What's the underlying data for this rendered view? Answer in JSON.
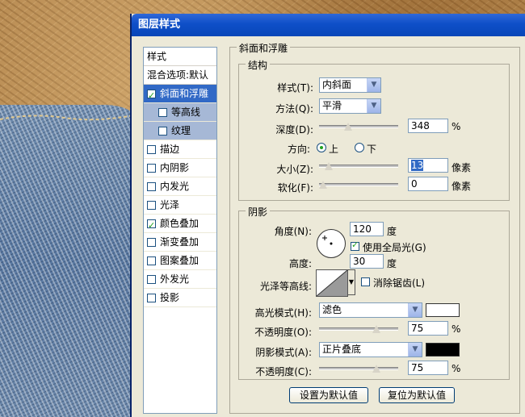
{
  "window": {
    "title": "图层样式"
  },
  "styles": {
    "header": "样式",
    "blend_default": "混合选项:默认",
    "items": [
      {
        "label": "斜面和浮雕",
        "checked": true,
        "selected": true,
        "sub": false
      },
      {
        "label": "等高线",
        "checked": false,
        "selected": false,
        "sub": true
      },
      {
        "label": "纹理",
        "checked": false,
        "selected": false,
        "sub": true
      },
      {
        "label": "描边",
        "checked": false,
        "selected": false,
        "sub": false
      },
      {
        "label": "内阴影",
        "checked": false,
        "selected": false,
        "sub": false
      },
      {
        "label": "内发光",
        "checked": false,
        "selected": false,
        "sub": false
      },
      {
        "label": "光泽",
        "checked": false,
        "selected": false,
        "sub": false
      },
      {
        "label": "颜色叠加",
        "checked": true,
        "selected": false,
        "sub": false
      },
      {
        "label": "渐变叠加",
        "checked": false,
        "selected": false,
        "sub": false
      },
      {
        "label": "图案叠加",
        "checked": false,
        "selected": false,
        "sub": false
      },
      {
        "label": "外发光",
        "checked": false,
        "selected": false,
        "sub": false
      },
      {
        "label": "投影",
        "checked": false,
        "selected": false,
        "sub": false
      }
    ]
  },
  "bevel": {
    "group_title": "斜面和浮雕",
    "structure_title": "结构",
    "style_label": "样式(T):",
    "style_value": "内斜面",
    "technique_label": "方法(Q):",
    "technique_value": "平滑",
    "depth_label": "深度(D):",
    "depth_value": "348",
    "depth_unit": "%",
    "depth_slider": 0.35,
    "direction_label": "方向:",
    "direction_up": "上",
    "direction_down": "下",
    "direction_selected": "up",
    "size_label": "大小(Z):",
    "size_value": "13",
    "size_unit": "像素",
    "size_slider": 0.08,
    "soften_label": "软化(F):",
    "soften_value": "0",
    "soften_unit": "像素",
    "soften_slider": 0.0
  },
  "shading": {
    "title": "阴影",
    "angle_label": "角度(N):",
    "angle_value": "120",
    "angle_unit": "度",
    "global_light_label": "使用全局光(G)",
    "global_light_checked": true,
    "altitude_label": "高度:",
    "altitude_value": "30",
    "altitude_unit": "度",
    "gloss_contour_label": "光泽等高线:",
    "anti_alias_label": "消除锯齿(L)",
    "anti_alias_checked": false,
    "highlight_mode_label": "高光模式(H):",
    "highlight_mode_value": "滤色",
    "highlight_color": "#ffffff",
    "highlight_opacity_label": "不透明度(O):",
    "highlight_opacity_value": "75",
    "highlight_opacity_unit": "%",
    "highlight_opacity_slider": 0.75,
    "shadow_mode_label": "阴影模式(A):",
    "shadow_mode_value": "正片叠底",
    "shadow_color": "#000000",
    "shadow_opacity_label": "不透明度(C):",
    "shadow_opacity_value": "75",
    "shadow_opacity_unit": "%",
    "shadow_opacity_slider": 0.75
  },
  "buttons": {
    "make_default": "设置为默认值",
    "reset_default": "复位为默认值"
  }
}
